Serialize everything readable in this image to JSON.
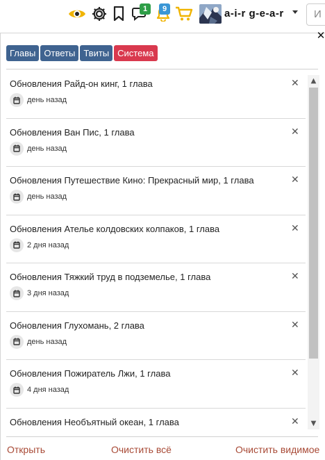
{
  "header": {
    "icons": [
      "eye-icon",
      "gear-icon",
      "bookmark-icon",
      "chat-icon",
      "bell-icon",
      "cart-icon"
    ],
    "chat_badge": "1",
    "bell_badge": "9",
    "username": "a-i-r g-e-a-r",
    "search_placeholder": "И",
    "colors": {
      "eye": "#f0b400",
      "bell": "#f0b400",
      "cart": "#f0b400",
      "chat_badge": "#2e9e47",
      "bell_badge": "#3a96d6"
    }
  },
  "panel": {
    "close_label": "✕",
    "tabs": [
      {
        "label": "Главы"
      },
      {
        "label": "Ответы"
      },
      {
        "label": "Твиты"
      },
      {
        "label": "Система"
      }
    ],
    "notifications": [
      {
        "title": "Обновления Райд-он кинг, 1 глава",
        "date": "день назад"
      },
      {
        "title": "Обновления Ван Пис, 1 глава",
        "date": "день назад"
      },
      {
        "title": "Обновления Путешествие Кино: Прекрасный мир, 1 глава",
        "date": "день назад"
      },
      {
        "title": "Обновления Ателье колдовских колпаков, 1 глава",
        "date": "2 дня назад"
      },
      {
        "title": "Обновления Тяжкий труд в подземелье, 1 глава",
        "date": "3 дня назад"
      },
      {
        "title": "Обновления Глухомань, 2 глава",
        "date": "день назад"
      },
      {
        "title": "Обновления Пожиратель Лжи, 1 глава",
        "date": "4 дня назад"
      },
      {
        "title": "Обновления Необъятный океан, 1 глава",
        "date": ""
      }
    ],
    "item_remove": "✕",
    "footer": {
      "open": "Открыть",
      "clear_all": "Очистить всё",
      "clear_visible": "Очистить видимое"
    }
  }
}
